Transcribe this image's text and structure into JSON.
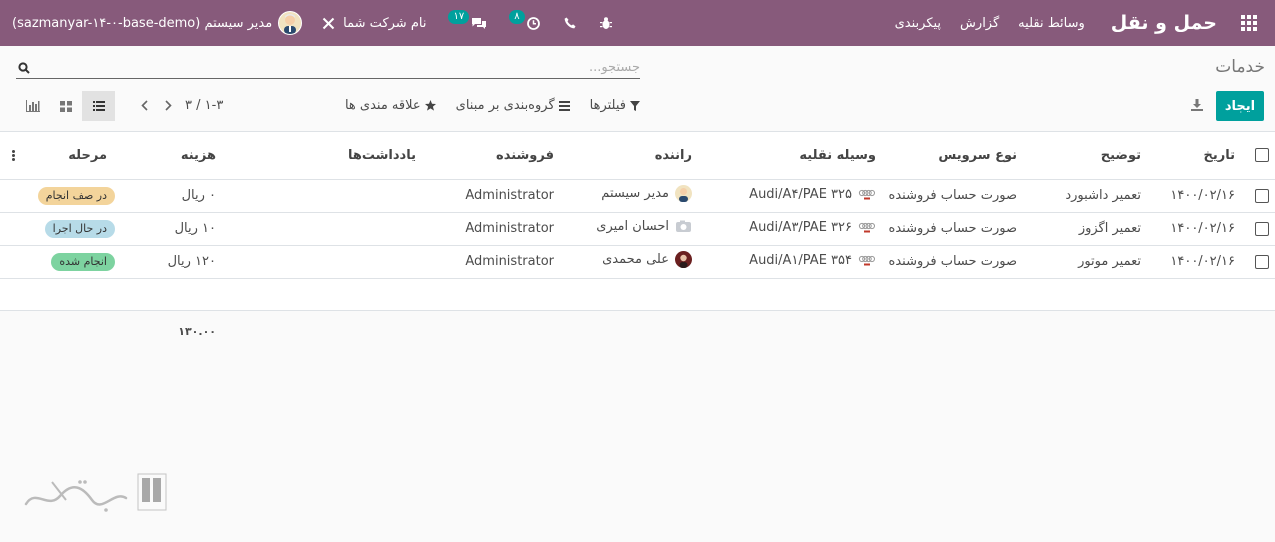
{
  "navbar": {
    "brand": "حمل و نقل",
    "menu": [
      "وسائط نقلیه",
      "گزارش",
      "پیکربندی"
    ],
    "company": "نام شرکت شما",
    "messages_count": "۱۷",
    "activities_count": "۸",
    "user": "مدیر سیستم (sazmanyar-۱۴-۰-base-demo)",
    "color": "#875a7b"
  },
  "control_panel": {
    "title": "خدمات",
    "search_placeholder": "جستجو...",
    "create_label": "ایجاد",
    "filters_label": "فیلترها",
    "groupby_label": "گروه‌بندی بر مبنای",
    "favorites_label": "علاقه مندی ها",
    "pager_value": "۱-۳ / ۳",
    "accent": "#00a09d"
  },
  "table": {
    "headers": {
      "date": "تاریخ",
      "description": "توضیح",
      "service_type": "نوع سرویس",
      "vehicle": "وسیله نقلیه",
      "driver": "راننده",
      "seller": "فروشنده",
      "notes": "یادداشت‌ها",
      "cost": "هزینه",
      "stage": "مرحله"
    },
    "rows": [
      {
        "date": "۱۴۰۰/۰۲/۱۶",
        "description": "تعمیر داشبورد",
        "service_type": "صورت حساب فروشنده",
        "vehicle": "Audi/A۴/PAE ۳۲۵",
        "driver": "مدیر سیستم",
        "seller": "Administrator",
        "notes": "",
        "cost": "۰ ریال",
        "stage": "در صف انجام",
        "stage_color": "#f3d49b"
      },
      {
        "date": "۱۴۰۰/۰۲/۱۶",
        "description": "تعمیر اگزوز",
        "service_type": "صورت حساب فروشنده",
        "vehicle": "Audi/A۳/PAE ۳۲۶",
        "driver": "احسان امیری",
        "seller": "Administrator",
        "notes": "",
        "cost": "۱۰ ریال",
        "stage": "در حال اجرا",
        "stage_color": "#b7dbe8"
      },
      {
        "date": "۱۴۰۰/۰۲/۱۶",
        "description": "تعمیر موتور",
        "service_type": "صورت حساب فروشنده",
        "vehicle": "Audi/A۱/PAE ۳۵۴",
        "driver": "علی محمدی",
        "seller": "Administrator",
        "notes": "",
        "cost": "۱۲۰ ریال",
        "stage": "انجام شده",
        "stage_color": "#7dd3a0"
      }
    ],
    "total_cost": "۱۳۰.۰۰"
  },
  "watermark": "تسهیل گستر"
}
